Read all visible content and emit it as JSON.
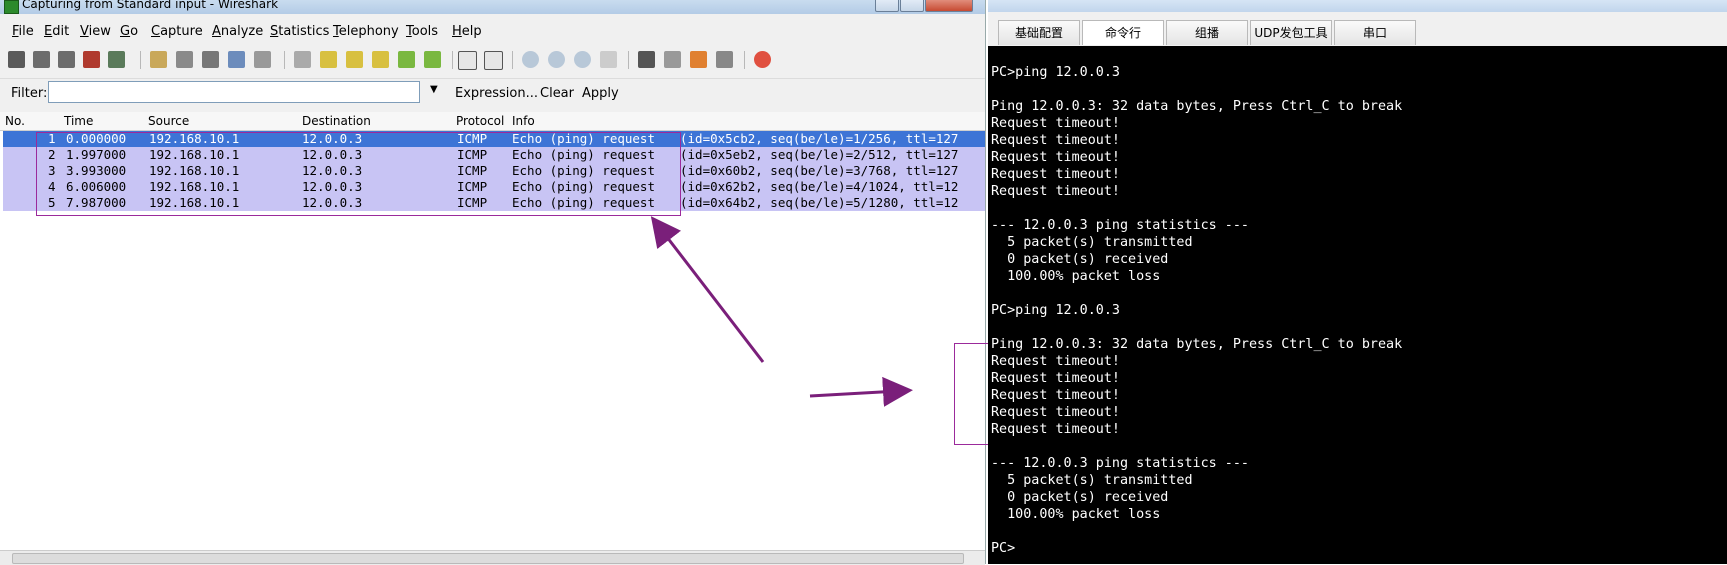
{
  "wireshark": {
    "title": "Capturing from Standard input - Wireshark",
    "menu": [
      "File",
      "Edit",
      "View",
      "Go",
      "Capture",
      "Analyze",
      "Statistics",
      "Telephony",
      "Tools",
      "Help"
    ],
    "filter": {
      "label": "Filter:",
      "value": "",
      "expression": "Expression...",
      "clear": "Clear",
      "apply": "Apply"
    },
    "columns": {
      "no": "No.",
      "time": "Time",
      "source": "Source",
      "destination": "Destination",
      "protocol": "Protocol",
      "info": "Info"
    },
    "packets": [
      {
        "no": "1",
        "time": "0.000000",
        "source": "192.168.10.1",
        "destination": "12.0.0.3",
        "protocol": "ICMP",
        "info": "Echo (ping) request",
        "detail": "(id=0x5cb2, seq(be/le)=1/256, ttl=127"
      },
      {
        "no": "2",
        "time": "1.997000",
        "source": "192.168.10.1",
        "destination": "12.0.0.3",
        "protocol": "ICMP",
        "info": "Echo (ping) request",
        "detail": "(id=0x5eb2, seq(be/le)=2/512, ttl=127"
      },
      {
        "no": "3",
        "time": "3.993000",
        "source": "192.168.10.1",
        "destination": "12.0.0.3",
        "protocol": "ICMP",
        "info": "Echo (ping) request",
        "detail": "(id=0x60b2, seq(be/le)=3/768, ttl=127"
      },
      {
        "no": "4",
        "time": "6.006000",
        "source": "192.168.10.1",
        "destination": "12.0.0.3",
        "protocol": "ICMP",
        "info": "Echo (ping) request",
        "detail": "(id=0x62b2, seq(be/le)=4/1024, ttl=12"
      },
      {
        "no": "5",
        "time": "7.987000",
        "source": "192.168.10.1",
        "destination": "12.0.0.3",
        "protocol": "ICMP",
        "info": "Echo (ping) request",
        "detail": "(id=0x64b2, seq(be/le)=5/1280, ttl=12"
      }
    ],
    "colors": {
      "selected_row": "#3d74d6",
      "packet_row": "#c8c4f4",
      "annotation": "#7a1f7a"
    }
  },
  "pc": {
    "tabs": [
      "基础配置",
      "命令行",
      "组播",
      "UDP发包工具",
      "串口"
    ],
    "active_tab": "命令行",
    "console": [
      "PC>ping 12.0.0.3",
      "",
      "Ping 12.0.0.3: 32 data bytes, Press Ctrl_C to break",
      "Request timeout!",
      "Request timeout!",
      "Request timeout!",
      "Request timeout!",
      "Request timeout!",
      "",
      "--- 12.0.0.3 ping statistics ---",
      "  5 packet(s) transmitted",
      "  0 packet(s) received",
      "  100.00% packet loss",
      "",
      "PC>ping 12.0.0.3",
      "",
      "Ping 12.0.0.3: 32 data bytes, Press Ctrl_C to break",
      "Request timeout!",
      "Request timeout!",
      "Request timeout!",
      "Request timeout!",
      "Request timeout!",
      "",
      "--- 12.0.0.3 ping statistics ---",
      "  5 packet(s) transmitted",
      "  0 packet(s) received",
      "  100.00% packet loss",
      "",
      "PC>"
    ]
  }
}
